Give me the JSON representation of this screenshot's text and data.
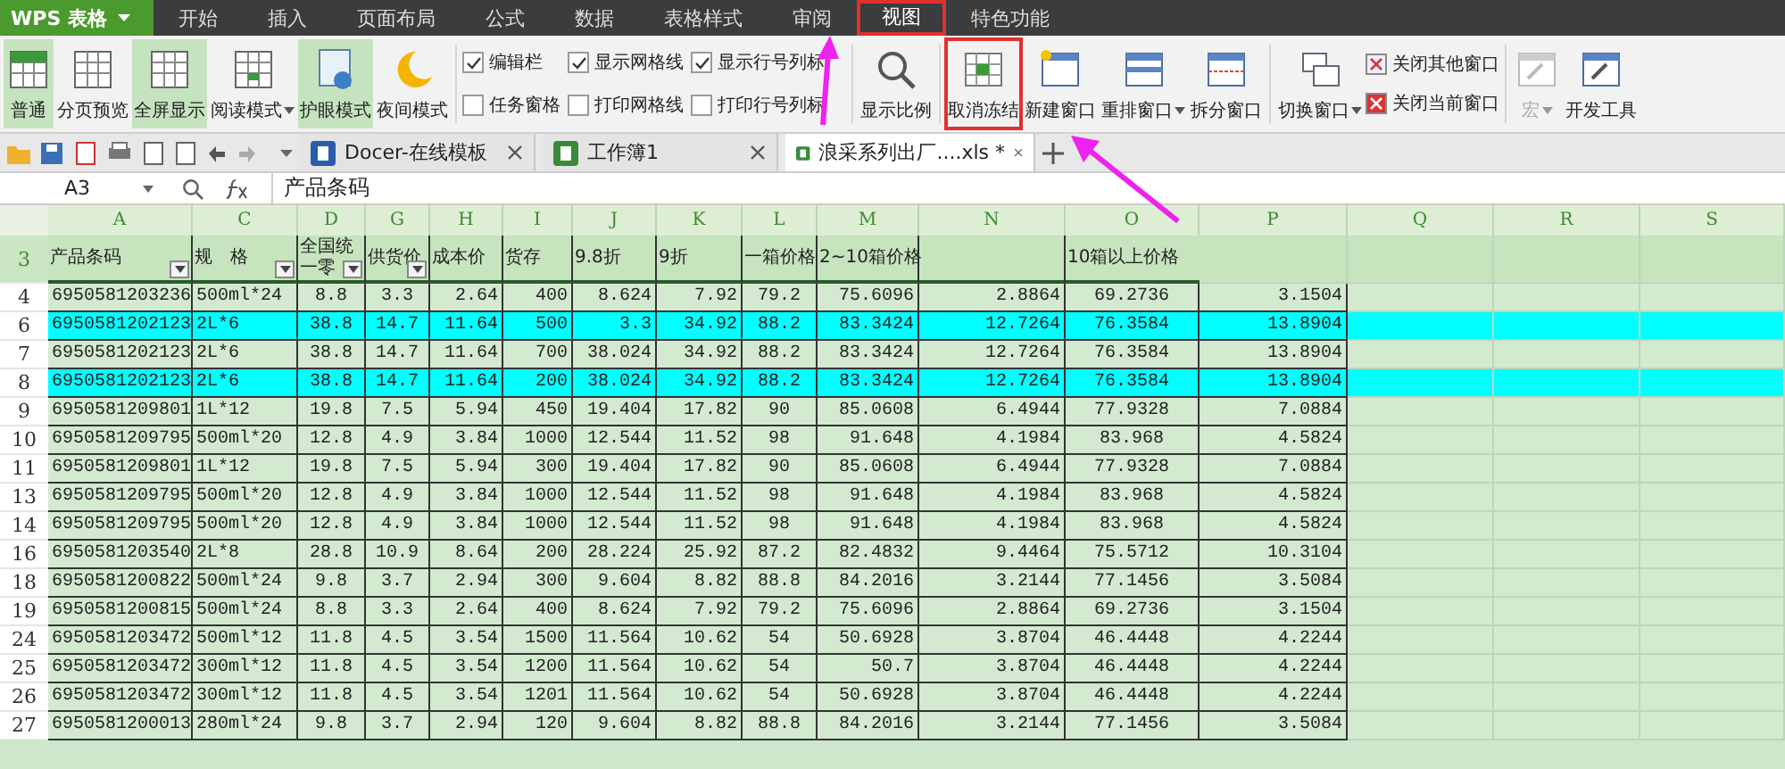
{
  "app": {
    "logo": "WPS 表格"
  },
  "menu_tabs": [
    {
      "label": "开始",
      "selected": false,
      "annotated": false
    },
    {
      "label": "插入",
      "selected": false,
      "annotated": false
    },
    {
      "label": "页面布局",
      "selected": false,
      "annotated": false
    },
    {
      "label": "公式",
      "selected": false,
      "annotated": false
    },
    {
      "label": "数据",
      "selected": false,
      "annotated": false
    },
    {
      "label": "表格样式",
      "selected": false,
      "annotated": false
    },
    {
      "label": "审阅",
      "selected": false,
      "annotated": false
    },
    {
      "label": "视图",
      "selected": true,
      "annotated": true
    },
    {
      "label": "特色功能",
      "selected": false,
      "annotated": false
    }
  ],
  "ribbon": {
    "view_buttons": [
      {
        "label": "普通",
        "pressed": true,
        "dropdown": false
      },
      {
        "label": "分页预览",
        "pressed": false,
        "dropdown": false
      },
      {
        "label": "全屏显示",
        "pressed": true,
        "dropdown": false
      },
      {
        "label": "阅读模式",
        "pressed": false,
        "dropdown": true
      },
      {
        "label": "护眼模式",
        "pressed": true,
        "dropdown": false
      },
      {
        "label": "夜间模式",
        "pressed": false,
        "dropdown": false
      }
    ],
    "checkboxes": [
      {
        "label": "编辑栏",
        "checked": true
      },
      {
        "label": "任务窗格",
        "checked": false
      },
      {
        "label": "显示网格线",
        "checked": true
      },
      {
        "label": "打印网格线",
        "checked": false
      },
      {
        "label": "显示行号列标",
        "checked": true
      },
      {
        "label": "打印行号列标",
        "checked": false
      }
    ],
    "window_buttons": [
      {
        "label": "显示比例",
        "dropdown": false,
        "annotated": false
      },
      {
        "label": "取消冻结",
        "dropdown": false,
        "annotated": true
      },
      {
        "label": "新建窗口",
        "dropdown": false,
        "annotated": false
      },
      {
        "label": "重排窗口",
        "dropdown": true,
        "annotated": false
      },
      {
        "label": "拆分窗口",
        "dropdown": false,
        "annotated": false
      },
      {
        "label": "切换窗口",
        "dropdown": true,
        "annotated": false
      }
    ],
    "small_buttons": [
      {
        "label": "关闭其他窗口"
      },
      {
        "label": "关闭当前窗口"
      }
    ],
    "tool_buttons": [
      {
        "label": "宏",
        "disabled": true,
        "dropdown": true
      },
      {
        "label": "开发工具",
        "disabled": false,
        "dropdown": false
      }
    ]
  },
  "doc_tabs": [
    {
      "label": "Docer-在线模板",
      "selected": false
    },
    {
      "label": "工作簿1",
      "selected": false
    },
    {
      "label": "浪采系列出厂....xls *",
      "selected": true
    }
  ],
  "formula_bar": {
    "name_box": "A3",
    "formula": "产品条码"
  },
  "sheet": {
    "columns": [
      "A",
      "C",
      "D",
      "G",
      "H",
      "I",
      "J",
      "K",
      "L",
      "M",
      "N",
      "O",
      "P",
      "Q",
      "R",
      "S"
    ],
    "header_row": {
      "number": "3",
      "cells": [
        {
          "text": "产品条码",
          "filter": true
        },
        {
          "text": "规　格",
          "filter": true
        },
        {
          "text": "全国统一零",
          "filter": true
        },
        {
          "text": "供货价",
          "filter": true
        },
        {
          "text": "成本价",
          "filter": false
        },
        {
          "text": "货存",
          "filter": false
        },
        {
          "text": "9.8折",
          "filter": false
        },
        {
          "text": "9折",
          "filter": false
        },
        {
          "text": "一箱价格",
          "filter": false
        },
        {
          "text": "2~10箱价格",
          "filter": false
        },
        {
          "filter": false
        },
        {
          "text": "10箱以上价格",
          "filter": false
        }
      ]
    },
    "rows": [
      {
        "number": "4",
        "highlighted": false,
        "cells": [
          "6950581203236",
          "500ml*24",
          "8.8",
          "3.3",
          "2.64",
          "400",
          "8.624",
          "7.92",
          "79.2",
          "75.6096",
          "2.8864",
          "69.2736",
          "3.1504"
        ]
      },
      {
        "number": "6",
        "highlighted": true,
        "cells": [
          "6950581202123",
          "2L*6",
          "38.8",
          "14.7",
          "11.64",
          "500",
          "3.3",
          "34.92",
          "88.2",
          "83.3424",
          "12.7264",
          "76.3584",
          "13.8904"
        ]
      },
      {
        "number": "7",
        "highlighted": false,
        "cells": [
          "6950581202123",
          "2L*6",
          "38.8",
          "14.7",
          "11.64",
          "700",
          "38.024",
          "34.92",
          "88.2",
          "83.3424",
          "12.7264",
          "76.3584",
          "13.8904"
        ]
      },
      {
        "number": "8",
        "highlighted": true,
        "cells": [
          "6950581202123",
          "2L*6",
          "38.8",
          "14.7",
          "11.64",
          "200",
          "38.024",
          "34.92",
          "88.2",
          "83.3424",
          "12.7264",
          "76.3584",
          "13.8904"
        ]
      },
      {
        "number": "9",
        "highlighted": false,
        "cells": [
          "6950581209801",
          "1L*12",
          "19.8",
          "7.5",
          "5.94",
          "450",
          "19.404",
          "17.82",
          "90",
          "85.0608",
          "6.4944",
          "77.9328",
          "7.0884"
        ]
      },
      {
        "number": "10",
        "highlighted": false,
        "cells": [
          "6950581209795",
          "500ml*20",
          "12.8",
          "4.9",
          "3.84",
          "1000",
          "12.544",
          "11.52",
          "98",
          "91.648",
          "4.1984",
          "83.968",
          "4.5824"
        ]
      },
      {
        "number": "11",
        "highlighted": false,
        "cells": [
          "6950581209801",
          "1L*12",
          "19.8",
          "7.5",
          "5.94",
          "300",
          "19.404",
          "17.82",
          "90",
          "85.0608",
          "6.4944",
          "77.9328",
          "7.0884"
        ]
      },
      {
        "number": "13",
        "highlighted": false,
        "cells": [
          "6950581209795",
          "500ml*20",
          "12.8",
          "4.9",
          "3.84",
          "1000",
          "12.544",
          "11.52",
          "98",
          "91.648",
          "4.1984",
          "83.968",
          "4.5824"
        ]
      },
      {
        "number": "14",
        "highlighted": false,
        "cells": [
          "6950581209795",
          "500ml*20",
          "12.8",
          "4.9",
          "3.84",
          "1000",
          "12.544",
          "11.52",
          "98",
          "91.648",
          "4.1984",
          "83.968",
          "4.5824"
        ]
      },
      {
        "number": "16",
        "highlighted": false,
        "cells": [
          "6950581203540",
          "2L*8",
          "28.8",
          "10.9",
          "8.64",
          "200",
          "28.224",
          "25.92",
          "87.2",
          "82.4832",
          "9.4464",
          "75.5712",
          "10.3104"
        ]
      },
      {
        "number": "18",
        "highlighted": false,
        "cells": [
          "6950581200822",
          "500ml*24",
          "9.8",
          "3.7",
          "2.94",
          "300",
          "9.604",
          "8.82",
          "88.8",
          "84.2016",
          "3.2144",
          "77.1456",
          "3.5084"
        ]
      },
      {
        "number": "19",
        "highlighted": false,
        "cells": [
          "6950581200815",
          "500ml*24",
          "8.8",
          "3.3",
          "2.64",
          "400",
          "8.624",
          "7.92",
          "79.2",
          "75.6096",
          "2.8864",
          "69.2736",
          "3.1504"
        ]
      },
      {
        "number": "24",
        "highlighted": false,
        "cells": [
          "6950581203472",
          "500ml*12",
          "11.8",
          "4.5",
          "3.54",
          "1500",
          "11.564",
          "10.62",
          "54",
          "50.6928",
          "3.8704",
          "46.4448",
          "4.2244"
        ]
      },
      {
        "number": "25",
        "highlighted": false,
        "cells": [
          "6950581203472",
          "300ml*12",
          "11.8",
          "4.5",
          "3.54",
          "1200",
          "11.564",
          "10.62",
          "54",
          "50.7",
          "3.8704",
          "46.4448",
          "4.2244"
        ]
      },
      {
        "number": "26",
        "highlighted": false,
        "cells": [
          "6950581203472",
          "300ml*12",
          "11.8",
          "4.5",
          "3.54",
          "1201",
          "11.564",
          "10.62",
          "54",
          "50.6928",
          "3.8704",
          "46.4448",
          "4.2244"
        ]
      },
      {
        "number": "27",
        "highlighted": false,
        "cells": [
          "6950581200013",
          "280ml*24",
          "9.8",
          "3.7",
          "2.94",
          "120",
          "9.604",
          "8.82",
          "88.8",
          "84.2016",
          "3.2144",
          "77.1456",
          "3.5084"
        ]
      }
    ]
  }
}
